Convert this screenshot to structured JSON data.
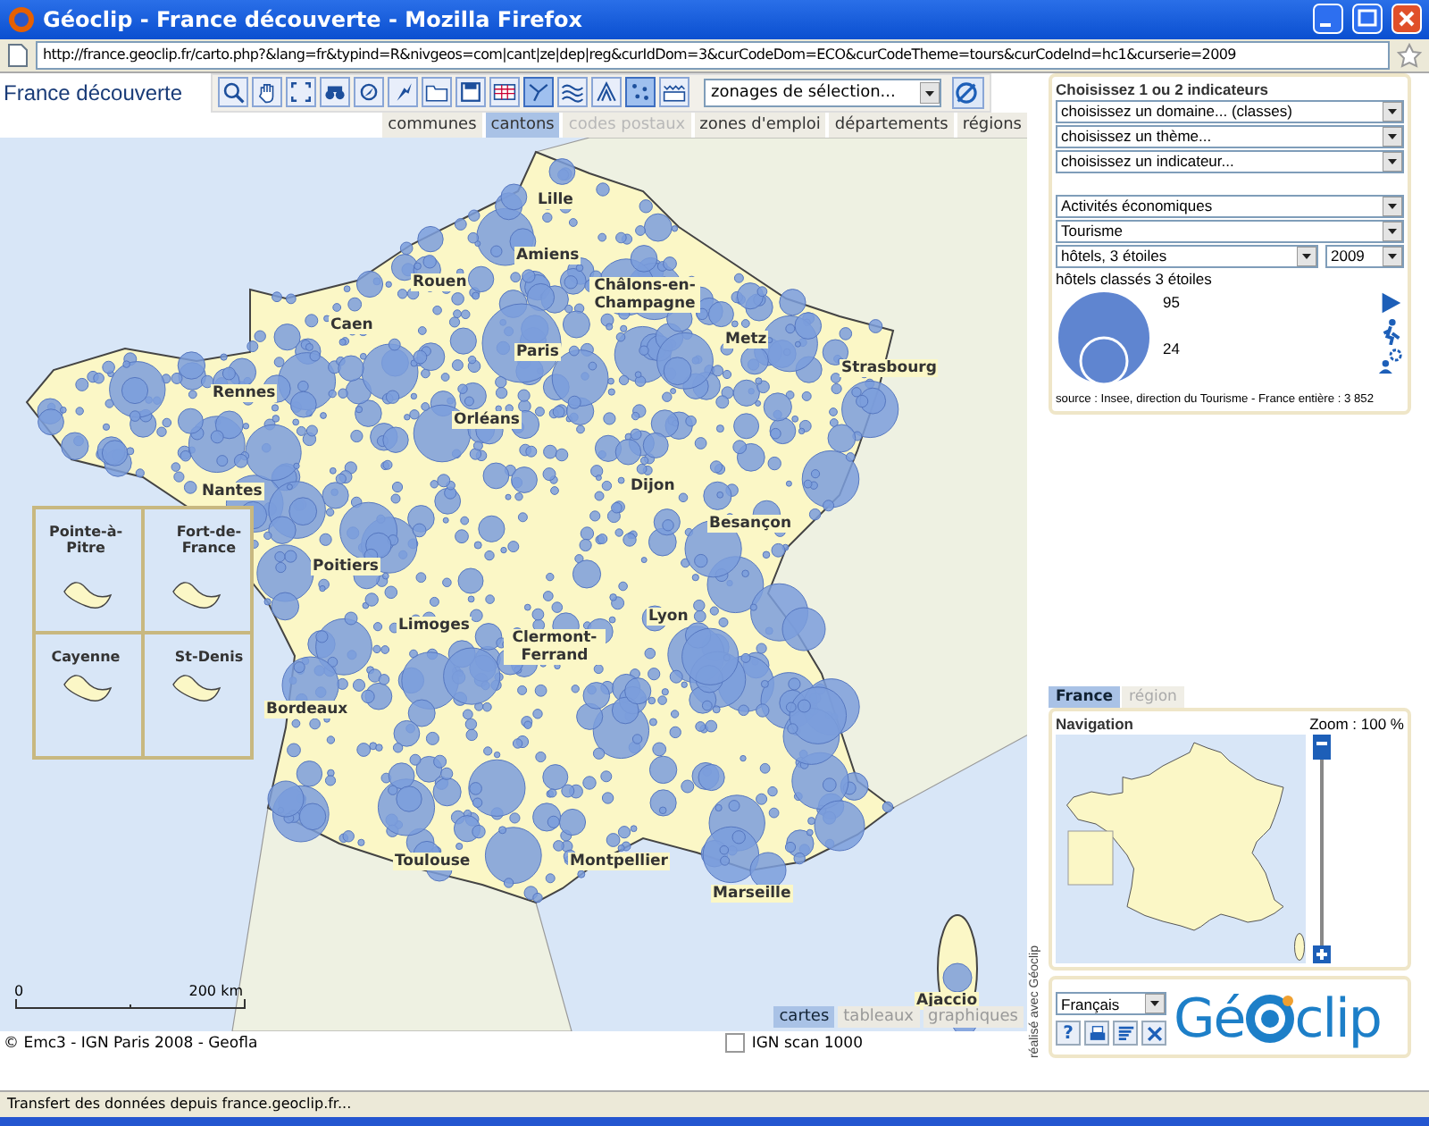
{
  "window": {
    "title": "Géoclip - France découverte - Mozilla Firefox"
  },
  "address_bar": {
    "url": "http://france.geoclip.fr/carto.php?&lang=fr&typind=R&nivgeos=com|cant|ze|dep|reg&curIdDom=3&curCodeDom=ECO&curCodeTheme=tours&curCodeInd=hc1&curserie=2009"
  },
  "app_title": "France découverte",
  "toolbar": {
    "tools": [
      {
        "kind": "zoom",
        "selected": false
      },
      {
        "kind": "pan",
        "selected": false
      },
      {
        "kind": "extent",
        "selected": false
      },
      {
        "kind": "binoculars",
        "selected": false
      },
      {
        "kind": "pin",
        "selected": false
      },
      {
        "kind": "pointer",
        "selected": false
      },
      {
        "kind": "folder",
        "selected": false
      },
      {
        "kind": "save",
        "selected": false
      },
      {
        "kind": "table",
        "selected": false
      },
      {
        "kind": "polyline",
        "selected": true
      },
      {
        "kind": "waves",
        "selected": false
      },
      {
        "kind": "triangle",
        "selected": false
      },
      {
        "kind": "points",
        "selected": true
      },
      {
        "kind": "legend",
        "selected": false
      }
    ],
    "zoning_select": "zonages de sélection..."
  },
  "level_tabs": [
    {
      "label": "communes",
      "selected": false,
      "disabled": false
    },
    {
      "label": "cantons",
      "selected": true,
      "disabled": false
    },
    {
      "label": "codes postaux",
      "selected": false,
      "disabled": true
    },
    {
      "label": "zones d'emploi",
      "selected": false,
      "disabled": false
    },
    {
      "label": "départements",
      "selected": false,
      "disabled": false
    },
    {
      "label": "régions",
      "selected": false,
      "disabled": false
    }
  ],
  "map": {
    "cities": [
      {
        "name": "Lille"
      },
      {
        "name": "Amiens"
      },
      {
        "name": "Rouen"
      },
      {
        "name": "Caen"
      },
      {
        "name": "Paris"
      },
      {
        "name": "Châlons-en-Champagne"
      },
      {
        "name": "Metz"
      },
      {
        "name": "Strasbourg"
      },
      {
        "name": "Rennes"
      },
      {
        "name": "Orléans"
      },
      {
        "name": "Nantes"
      },
      {
        "name": "Dijon"
      },
      {
        "name": "Besançon"
      },
      {
        "name": "Poitiers"
      },
      {
        "name": "Limoges"
      },
      {
        "name": "Clermont-Ferrand"
      },
      {
        "name": "Lyon"
      },
      {
        "name": "Bordeaux"
      },
      {
        "name": "Toulouse"
      },
      {
        "name": "Montpellier"
      },
      {
        "name": "Marseille"
      },
      {
        "name": "Ajaccio"
      }
    ],
    "insets": [
      {
        "name": "Pointe-à-Pitre"
      },
      {
        "name": "Fort-de-France"
      },
      {
        "name": "Cayenne"
      },
      {
        "name": "St-Denis"
      }
    ],
    "scale": {
      "start": "0",
      "end": "200 km"
    },
    "view_tabs": [
      {
        "label": "cartes",
        "selected": true
      },
      {
        "label": "tableaux",
        "selected": false
      },
      {
        "label": "graphiques",
        "selected": false
      }
    ]
  },
  "copyright": "© Emc3 - IGN Paris 2008 - Geofla",
  "ign_scan": {
    "label": "IGN scan 1000",
    "checked": false
  },
  "credit": "réalisé avec Géoclip",
  "indicators": {
    "heading": "Choisissez 1 ou 2 indicateurs",
    "chooser": [
      "choisissez un domaine... (classes)",
      "choisissez un thème...",
      "choisissez un indicateur..."
    ],
    "domain": "Activités économiques",
    "theme": "Tourisme",
    "indicator": "hôtels, 3 étoiles",
    "year": "2009",
    "legend_title": "hôtels classés 3 étoiles",
    "legend_max": "95",
    "legend_min": "24",
    "actions": [
      {
        "kind": "play"
      },
      {
        "kind": "walker"
      },
      {
        "kind": "settings"
      }
    ],
    "source": "source : Insee, direction du Tourisme - France entière : 3 852"
  },
  "navigation": {
    "tabs": [
      {
        "label": "France",
        "selected": true
      },
      {
        "label": "région",
        "selected": false
      }
    ],
    "title": "Navigation",
    "zoom": "Zoom : 100 %",
    "zoom_slider": {
      "level": 0
    }
  },
  "footer": {
    "language": "Français",
    "buttons": [
      {
        "kind": "help",
        "label": "?"
      },
      {
        "kind": "print"
      },
      {
        "kind": "list"
      },
      {
        "kind": "close"
      }
    ],
    "logo_left": "Gé",
    "logo_right": "clip"
  },
  "status_bar": "Transfert des données depuis france.geoclip.fr..."
}
